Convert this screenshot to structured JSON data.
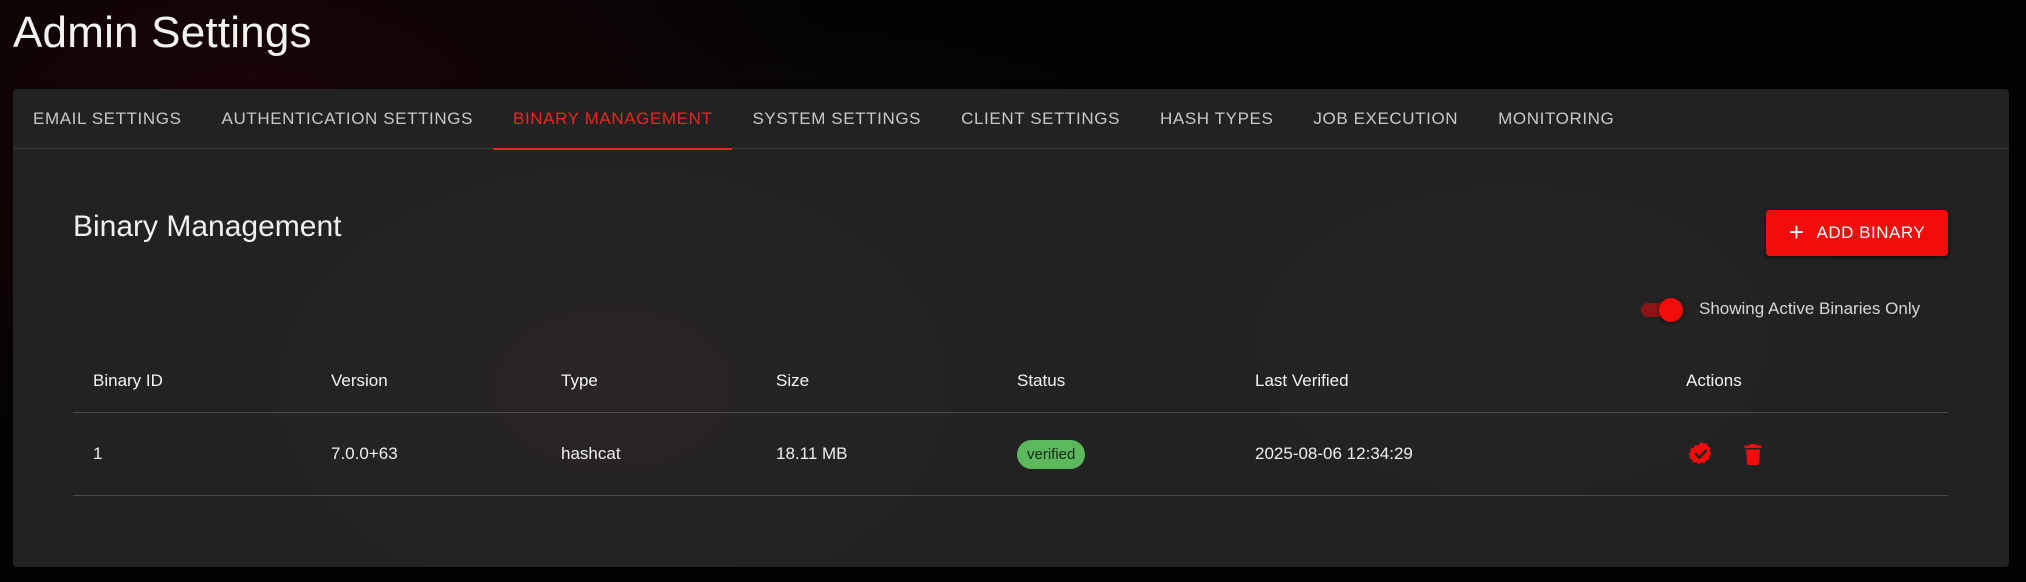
{
  "page": {
    "title": "Admin Settings"
  },
  "tabs": [
    {
      "label": "EMAIL SETTINGS"
    },
    {
      "label": "AUTHENTICATION SETTINGS"
    },
    {
      "label": "BINARY MANAGEMENT",
      "active": true
    },
    {
      "label": "SYSTEM SETTINGS"
    },
    {
      "label": "CLIENT SETTINGS"
    },
    {
      "label": "HASH TYPES"
    },
    {
      "label": "JOB EXECUTION"
    },
    {
      "label": "MONITORING"
    }
  ],
  "section": {
    "title": "Binary Management",
    "add_button_label": "ADD BINARY",
    "toggle_label": "Showing Active Binaries Only",
    "toggle_on": true
  },
  "table": {
    "columns": [
      "Binary ID",
      "Version",
      "Type",
      "Size",
      "Status",
      "Last Verified",
      "Actions"
    ],
    "rows": [
      {
        "id": "1",
        "version": "7.0.0+63",
        "type": "hashcat",
        "size": "18.11 MB",
        "status": "verified",
        "last_verified": "2025-08-06 12:34:29",
        "actions": [
          "verify-icon",
          "trash-icon"
        ]
      }
    ]
  },
  "colors": {
    "accent": "#f20d0d",
    "active_tab": "#e8261d",
    "status_verified": "#5cb85c",
    "panel": "#222222"
  }
}
